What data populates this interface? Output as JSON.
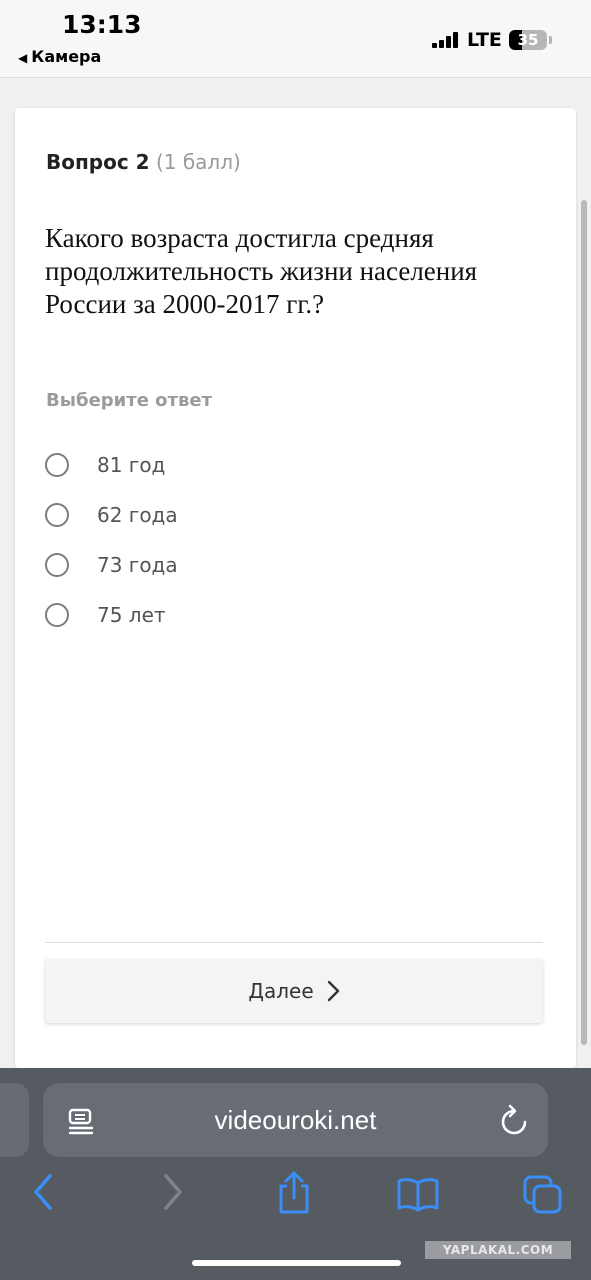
{
  "status_bar": {
    "time": "13:13",
    "back_label": "Камера",
    "network": "LTE",
    "battery": "35",
    "battery_level": 0.35
  },
  "question": {
    "title": "Вопрос 2",
    "points": "(1 балл)",
    "text": "Какого возраста достигла средняя продолжительность жизни населения России за 2000-2017 гг.?",
    "hint": "Выберите ответ",
    "options": [
      "81 год",
      "62 года",
      "73 года",
      "75 лет"
    ],
    "next_label": "Далее"
  },
  "browser": {
    "url": "videouroki.net",
    "icons": [
      "reader-icon",
      "reload-icon",
      "back-icon",
      "forward-icon",
      "share-icon",
      "bookmarks-icon",
      "tabs-icon"
    ]
  },
  "watermark": "YAPLAKAL.COM",
  "colors": {
    "ios_blue": "#3a8ef6",
    "toolbar": "#565a61",
    "radio": "#7d7d7d"
  }
}
